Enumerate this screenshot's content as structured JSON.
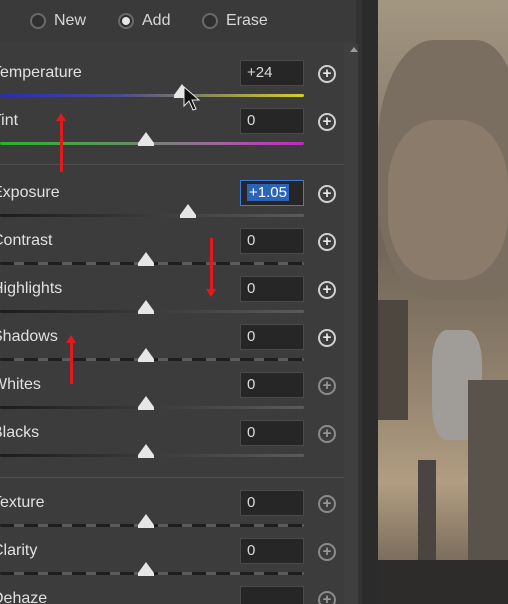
{
  "modes": [
    {
      "label": "New",
      "selected": false
    },
    {
      "label": "Add",
      "selected": true
    },
    {
      "label": "Erase",
      "selected": false
    }
  ],
  "sliders": [
    {
      "label": "Temperature",
      "value": "+24",
      "track": "temp",
      "position": 0.6
    },
    {
      "label": "Tint",
      "value": "0",
      "track": "tint",
      "position": 0.48
    },
    {
      "label": "Exposure",
      "value": "+1.05",
      "track": "plain",
      "position": 0.62,
      "selected": true
    },
    {
      "label": "Contrast",
      "value": "0",
      "track": "dashed",
      "position": 0.48
    },
    {
      "label": "Highlights",
      "value": "0",
      "track": "plain",
      "position": 0.48
    },
    {
      "label": "Shadows",
      "value": "0",
      "track": "dashed",
      "position": 0.48
    },
    {
      "label": "Whites",
      "value": "0",
      "track": "plain",
      "position": 0.48
    },
    {
      "label": "Blacks",
      "value": "0",
      "track": "plain",
      "position": 0.48
    },
    {
      "label": "Texture",
      "value": "0",
      "track": "dashed",
      "position": 0.48
    },
    {
      "label": "Clarity",
      "value": "0",
      "track": "dashed",
      "position": 0.48
    },
    {
      "label": "Dehaze",
      "value": "",
      "track": "plain",
      "position": 0.48
    }
  ],
  "colors": {
    "annotation_arrow": "#e11b1b",
    "selection": "#2a63b8"
  },
  "icons": {
    "add": "plus-circle-icon",
    "cursor": "mouse-pointer-icon",
    "scroll": "scroll-up-icon"
  }
}
